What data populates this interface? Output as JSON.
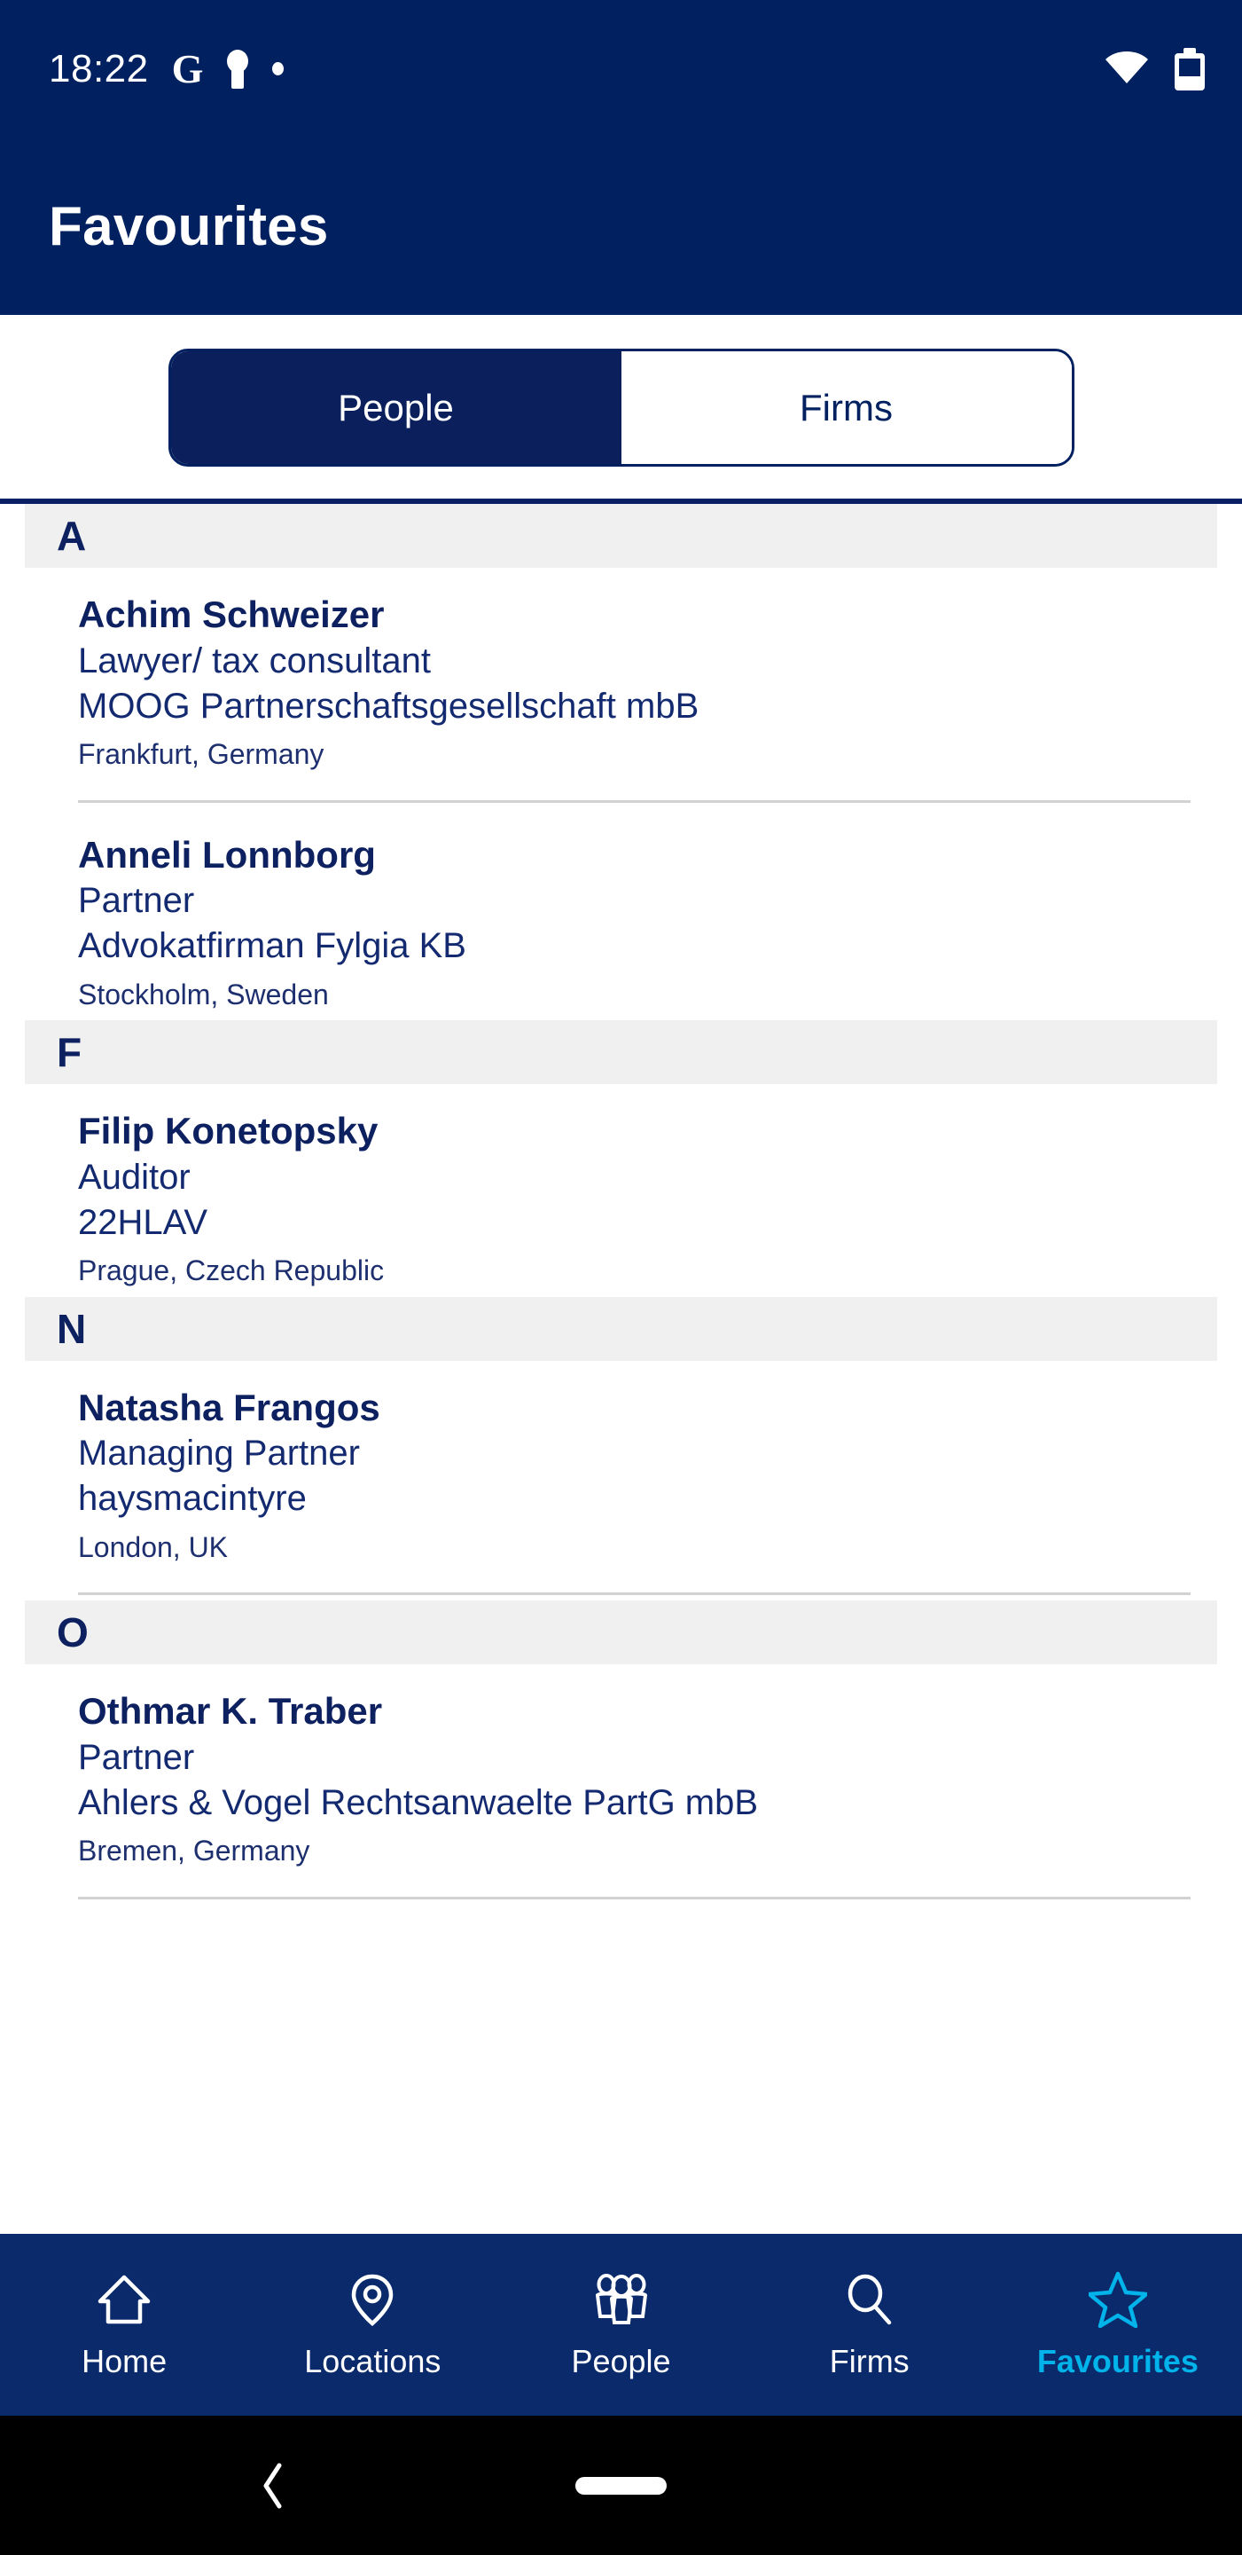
{
  "status_bar": {
    "time": "18:22",
    "icons_left": [
      "google-g-icon",
      "keyhole-icon",
      "dot-icon"
    ],
    "icons_right": [
      "wifi-icon",
      "battery-icon"
    ]
  },
  "header": {
    "title": "Favourites"
  },
  "segment_control": {
    "tabs": [
      {
        "label": "People",
        "active": true
      },
      {
        "label": "Firms",
        "active": false
      }
    ]
  },
  "list": {
    "sections": [
      {
        "letter": "A",
        "entries": [
          {
            "name": "Achim Schweizer",
            "title": "Lawyer/ tax consultant",
            "firm": "MOOG Partnerschaftsgesellschaft mbB",
            "location": "Frankfurt, Germany"
          },
          {
            "name": "Anneli Lonnborg",
            "title": "Partner",
            "firm": "Advokatfirman Fylgia KB",
            "location": "Stockholm, Sweden"
          }
        ]
      },
      {
        "letter": "F",
        "entries": [
          {
            "name": "Filip Konetopsky",
            "title": "Auditor",
            "firm": "22HLAV",
            "location": "Prague, Czech Republic"
          }
        ]
      },
      {
        "letter": "N",
        "entries": [
          {
            "name": "Natasha Frangos",
            "title": "Managing Partner",
            "firm": "haysmacintyre",
            "location": "London, UK"
          }
        ]
      },
      {
        "letter": "O",
        "entries": [
          {
            "name": "Othmar K. Traber",
            "title": "Partner",
            "firm": "Ahlers & Vogel Rechtsanwaelte PartG mbB",
            "location": "Bremen, Germany"
          }
        ]
      }
    ]
  },
  "bottom_nav": {
    "items": [
      {
        "label": "Home",
        "icon": "home-icon",
        "active": false
      },
      {
        "label": "Locations",
        "icon": "map-pin-icon",
        "active": false
      },
      {
        "label": "People",
        "icon": "people-group-icon",
        "active": false
      },
      {
        "label": "Firms",
        "icon": "search-icon",
        "active": false
      },
      {
        "label": "Favourites",
        "icon": "star-icon",
        "active": true
      }
    ]
  },
  "system_nav": {
    "back": "back-chevron-icon",
    "home": "home-pill-icon"
  },
  "colors": {
    "navy": "#002060",
    "nav_navy": "#0a2a6b",
    "accent_cyan": "#00b3ea",
    "band_gray": "#f0f0f0",
    "divider_gray": "#d2d2d2",
    "text_navy": "#0d2060"
  }
}
